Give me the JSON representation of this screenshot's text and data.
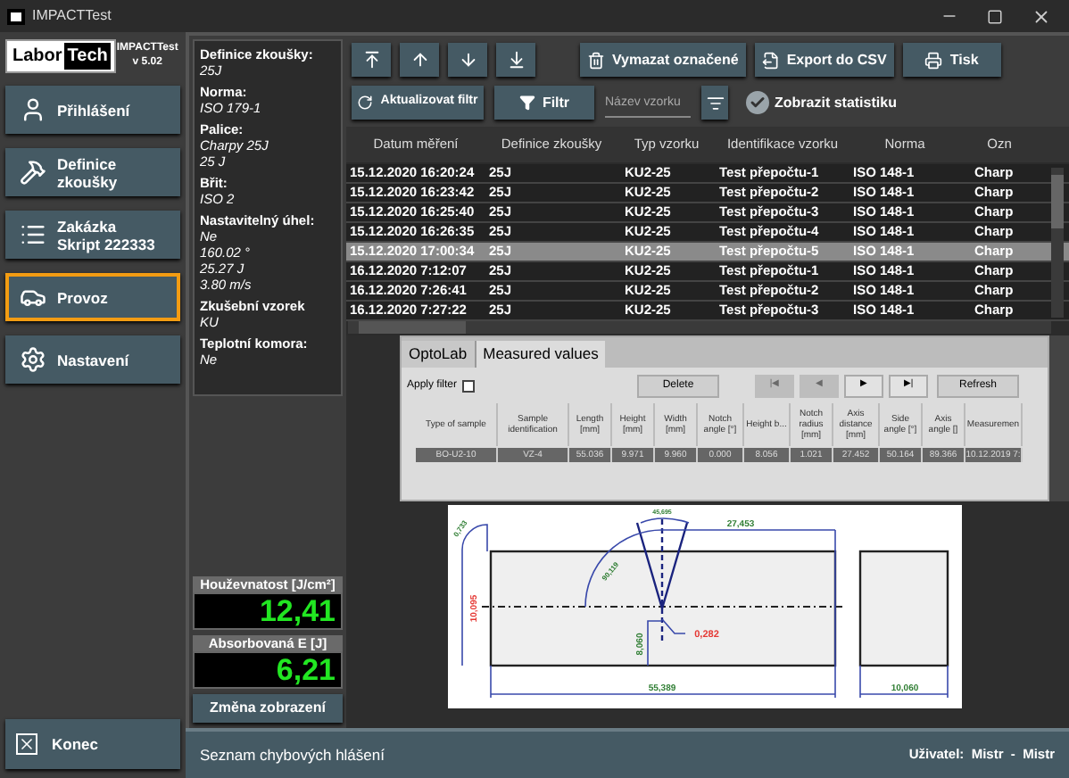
{
  "window": {
    "title": "IMPACTTest"
  },
  "logo": {
    "brand_left": "Labor",
    "brand_right": "Tech",
    "app_name": "IMPACTTest",
    "version": "v 5.02"
  },
  "nav": [
    {
      "kind": "user",
      "label": "Přihlášení",
      "selected": false
    },
    {
      "kind": "hammer",
      "label": "Definice zkoušky",
      "selected": false
    },
    {
      "kind": "list",
      "label": "Zakázka",
      "sublabel": "Skript 222333",
      "selected": false
    },
    {
      "kind": "car",
      "label": "Provoz",
      "selected": true
    },
    {
      "kind": "gear",
      "label": "Nastavení",
      "selected": false
    }
  ],
  "exit_button": "Konec",
  "info": [
    {
      "label": "Definice zkoušky:",
      "values": [
        "25J"
      ]
    },
    {
      "label": "Norma:",
      "values": [
        "ISO 179-1"
      ]
    },
    {
      "label": "Palice:",
      "values": [
        "Charpy 25J",
        "25 J"
      ]
    },
    {
      "label": "Břit:",
      "values": [
        "ISO 2"
      ]
    },
    {
      "label": "Nastavitelný úhel:",
      "values": [
        "Ne",
        "160.02 °",
        "25.27 J",
        "3.80 m/s"
      ]
    },
    {
      "label": "Zkušební vzorek",
      "values": [
        "KU"
      ]
    },
    {
      "label": "Teplotní komora:",
      "values": [
        "Ne"
      ]
    }
  ],
  "readouts": [
    {
      "label": "Houževnatost [J/cm²]",
      "value": "12,41"
    },
    {
      "label": "Absorbovaná E [J]",
      "value": "6,21"
    }
  ],
  "toggle_button": "Změna zobrazení",
  "move_buttons": [
    {
      "kind": "top"
    },
    {
      "kind": "up"
    },
    {
      "kind": "down"
    },
    {
      "kind": "bottom"
    }
  ],
  "actions": [
    {
      "kind": "trash",
      "label": "Vymazat označené"
    },
    {
      "kind": "export",
      "label": "Export do CSV"
    },
    {
      "kind": "print",
      "label": "Tisk"
    }
  ],
  "refresh_filter": "Aktualizovat filtr",
  "filter": "Filtr",
  "search": {
    "placeholder": "Název vzorku"
  },
  "show_stats": {
    "label": "Zobrazit statistiku",
    "checked": true
  },
  "table": {
    "columns": [
      "Datum měření",
      "Definice zkoušky",
      "Typ vzorku",
      "Identifikace vzorku",
      "Norma",
      "Ozn"
    ],
    "rows": [
      {
        "cells": [
          "15.12.2020 16:20:24",
          "25J",
          "KU2-25",
          "Test přepočtu-1",
          "ISO 148-1",
          "Charp"
        ],
        "selected": false
      },
      {
        "cells": [
          "15.12.2020 16:23:42",
          "25J",
          "KU2-25",
          "Test přepočtu-2",
          "ISO 148-1",
          "Charp"
        ],
        "selected": false
      },
      {
        "cells": [
          "15.12.2020 16:25:40",
          "25J",
          "KU2-25",
          "Test přepočtu-3",
          "ISO 148-1",
          "Charp"
        ],
        "selected": false
      },
      {
        "cells": [
          "15.12.2020 16:26:35",
          "25J",
          "KU2-25",
          "Test přepočtu-4",
          "ISO 148-1",
          "Charp"
        ],
        "selected": false
      },
      {
        "cells": [
          "15.12.2020 17:00:34",
          "25J",
          "KU2-25",
          "Test přepočtu-5",
          "ISO 148-1",
          "Charp"
        ],
        "selected": true
      },
      {
        "cells": [
          "16.12.2020 7:12:07",
          "25J",
          "KU2-25",
          "Test přepočtu-1",
          "ISO 148-1",
          "Charp"
        ],
        "selected": false
      },
      {
        "cells": [
          "16.12.2020 7:26:41",
          "25J",
          "KU2-25",
          "Test přepočtu-2",
          "ISO 148-1",
          "Charp"
        ],
        "selected": false
      },
      {
        "cells": [
          "16.12.2020 7:27:22",
          "25J",
          "KU2-25",
          "Test přepočtu-3",
          "ISO 148-1",
          "Charp"
        ],
        "selected": false
      }
    ]
  },
  "optolab": {
    "tabs": [
      {
        "label": "OptoLab",
        "selected": false
      },
      {
        "label": "Measured values",
        "selected": true
      }
    ],
    "apply_filter": {
      "label": "Apply filter",
      "checked": false
    },
    "delete": "Delete",
    "pager": [
      {
        "label": "|◀",
        "disabled": true
      },
      {
        "label": "◀",
        "disabled": true
      },
      {
        "label": "▶",
        "disabled": false
      },
      {
        "label": "▶|",
        "disabled": false
      }
    ],
    "refresh": "Refresh",
    "columns": [
      "Type of sample",
      "Sample identification",
      "Length [mm]",
      "Height [mm]",
      "Width [mm]",
      "Notch angle [°]",
      "Height b...",
      "Notch radius [mm]",
      "Axis distance [mm]",
      "Side angle [°]",
      "Axis angle []",
      "Measuremen"
    ],
    "rows": [
      {
        "cells": [
          "BO-U2-10",
          "VZ-4",
          "55.036",
          "9.971",
          "9.960",
          "0.000",
          "8.056",
          "1.021",
          "27.452",
          "50.164",
          "89.366",
          "10.12.2019 7:"
        ],
        "selected": true
      }
    ]
  },
  "diagram": {
    "labels": [
      "0,733",
      "45,695",
      "27,453",
      "90,119",
      "10,095",
      "0,282",
      "8,060",
      "55,389",
      "10,060"
    ]
  },
  "status_bar": {
    "left": "Seznam chybových hlášení",
    "user": "Uživatel:  Mistr  -  Mistr"
  }
}
